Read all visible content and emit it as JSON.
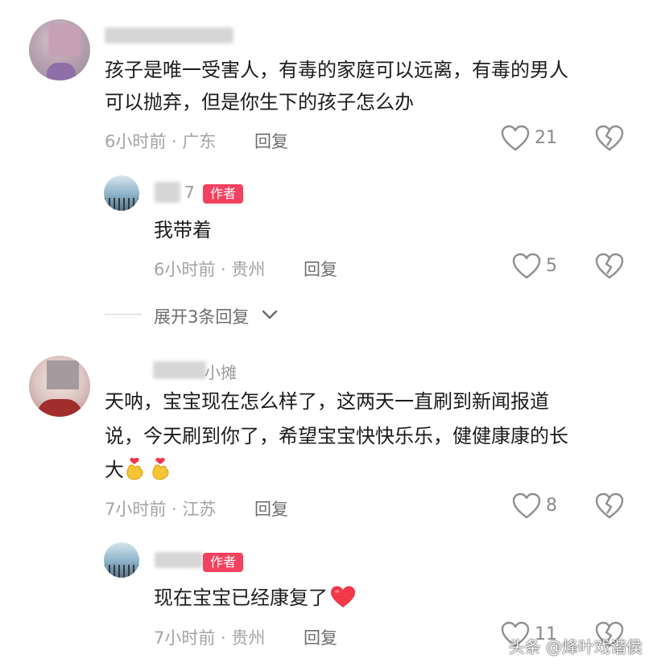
{
  "comments": [
    {
      "username_visible": "",
      "text_line1": "孩子是唯一受害人，有毒的家庭可以远离，有毒的男人",
      "text_line2": "可以抛弃，但是你生下的孩子怎么办",
      "meta": "6小时前 · 广东",
      "reply_label": "回复",
      "like_count": "21",
      "reply": {
        "username_visible": "7",
        "badge": "作者",
        "text": "我带着",
        "meta": "6小时前 · 贵州",
        "reply_label": "回复",
        "like_count": "5"
      },
      "expand_label": "展开3条回复"
    },
    {
      "username_visible": "小摊",
      "text_line1": "天呐，宝宝现在怎么样了，这两天一直刷到新闻报道",
      "text_line2": "说，今天刷到你了，希望宝宝快快乐乐，健健康康的长",
      "text_line3": "大",
      "meta": "7小时前 · 江苏",
      "reply_label": "回复",
      "like_count": "8",
      "reply": {
        "username_visible": "",
        "badge": "作者",
        "text": "现在宝宝已经康复了",
        "meta": "7小时前 · 贵州",
        "reply_label": "回复",
        "like_count": "11"
      }
    }
  ],
  "icons": {
    "like": "heart-outline-icon",
    "dislike": "broken-heart-icon",
    "expand": "chevron-down-icon",
    "emoji_hand": "finger-heart-emoji",
    "emoji_heart": "red-heart-emoji"
  },
  "colors": {
    "badge": "#f3415f",
    "heart_emoji": "#f2384b",
    "hand_emoji": "#f5c431"
  },
  "watermark": "头条 @烽叶戏谐侯"
}
